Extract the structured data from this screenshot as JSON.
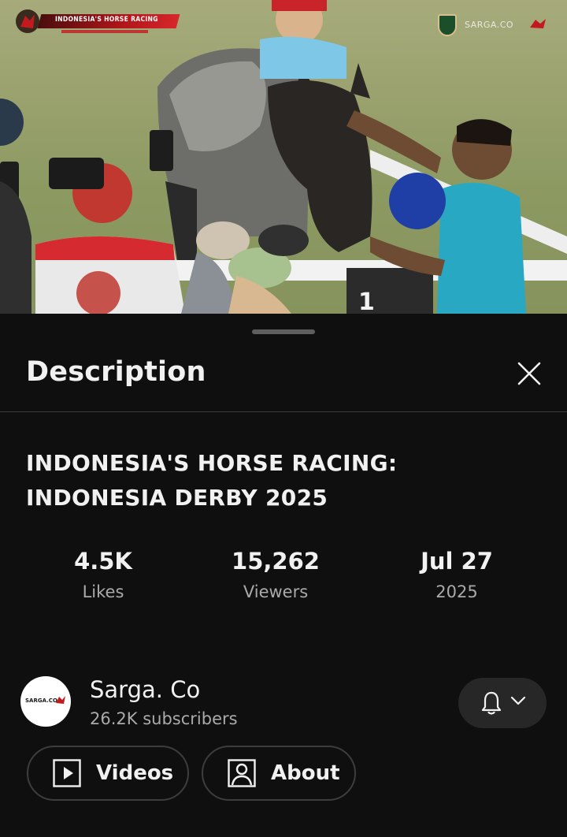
{
  "video_overlay": {
    "title_banner": "INDONESIA'S HORSE RACING",
    "brand_watermark": "SARGA.CO"
  },
  "sheet": {
    "title": "Description",
    "close_icon": "close-icon"
  },
  "video": {
    "title_line1": "INDONESIA'S HORSE RACING:",
    "title_line2": "INDONESIA DERBY 2025"
  },
  "stats": [
    {
      "value": "4.5K",
      "label": "Likes"
    },
    {
      "value": "15,262",
      "label": "Viewers"
    },
    {
      "value": "Jul 27",
      "label": "2025"
    }
  ],
  "channel": {
    "name": "Sarga. Co",
    "subscribers": "26.2K subscribers",
    "avatar_text": "SARGA.CO",
    "notification_icon": "bell-icon"
  },
  "buttons": {
    "videos": "Videos",
    "about": "About"
  },
  "colors": {
    "background": "#0f0f0f",
    "text_primary": "#f1f1f1",
    "text_secondary": "#aaaaaa",
    "chip": "#272727",
    "brand_red": "#c21a1f"
  }
}
